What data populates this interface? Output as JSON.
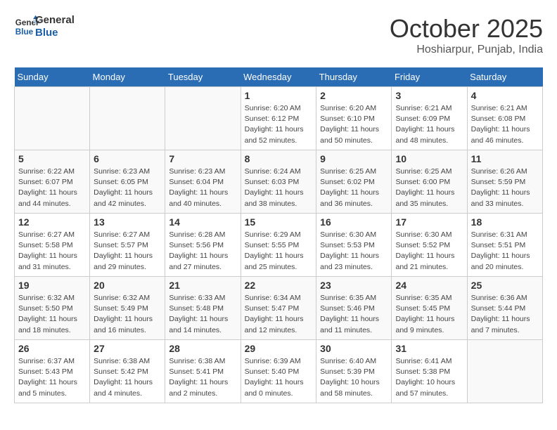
{
  "logo": {
    "line1": "General",
    "line2": "Blue"
  },
  "title": "October 2025",
  "location": "Hoshiarpur, Punjab, India",
  "weekdays": [
    "Sunday",
    "Monday",
    "Tuesday",
    "Wednesday",
    "Thursday",
    "Friday",
    "Saturday"
  ],
  "weeks": [
    [
      {
        "day": "",
        "info": ""
      },
      {
        "day": "",
        "info": ""
      },
      {
        "day": "",
        "info": ""
      },
      {
        "day": "1",
        "info": "Sunrise: 6:20 AM\nSunset: 6:12 PM\nDaylight: 11 hours\nand 52 minutes."
      },
      {
        "day": "2",
        "info": "Sunrise: 6:20 AM\nSunset: 6:10 PM\nDaylight: 11 hours\nand 50 minutes."
      },
      {
        "day": "3",
        "info": "Sunrise: 6:21 AM\nSunset: 6:09 PM\nDaylight: 11 hours\nand 48 minutes."
      },
      {
        "day": "4",
        "info": "Sunrise: 6:21 AM\nSunset: 6:08 PM\nDaylight: 11 hours\nand 46 minutes."
      }
    ],
    [
      {
        "day": "5",
        "info": "Sunrise: 6:22 AM\nSunset: 6:07 PM\nDaylight: 11 hours\nand 44 minutes."
      },
      {
        "day": "6",
        "info": "Sunrise: 6:23 AM\nSunset: 6:05 PM\nDaylight: 11 hours\nand 42 minutes."
      },
      {
        "day": "7",
        "info": "Sunrise: 6:23 AM\nSunset: 6:04 PM\nDaylight: 11 hours\nand 40 minutes."
      },
      {
        "day": "8",
        "info": "Sunrise: 6:24 AM\nSunset: 6:03 PM\nDaylight: 11 hours\nand 38 minutes."
      },
      {
        "day": "9",
        "info": "Sunrise: 6:25 AM\nSunset: 6:02 PM\nDaylight: 11 hours\nand 36 minutes."
      },
      {
        "day": "10",
        "info": "Sunrise: 6:25 AM\nSunset: 6:00 PM\nDaylight: 11 hours\nand 35 minutes."
      },
      {
        "day": "11",
        "info": "Sunrise: 6:26 AM\nSunset: 5:59 PM\nDaylight: 11 hours\nand 33 minutes."
      }
    ],
    [
      {
        "day": "12",
        "info": "Sunrise: 6:27 AM\nSunset: 5:58 PM\nDaylight: 11 hours\nand 31 minutes."
      },
      {
        "day": "13",
        "info": "Sunrise: 6:27 AM\nSunset: 5:57 PM\nDaylight: 11 hours\nand 29 minutes."
      },
      {
        "day": "14",
        "info": "Sunrise: 6:28 AM\nSunset: 5:56 PM\nDaylight: 11 hours\nand 27 minutes."
      },
      {
        "day": "15",
        "info": "Sunrise: 6:29 AM\nSunset: 5:55 PM\nDaylight: 11 hours\nand 25 minutes."
      },
      {
        "day": "16",
        "info": "Sunrise: 6:30 AM\nSunset: 5:53 PM\nDaylight: 11 hours\nand 23 minutes."
      },
      {
        "day": "17",
        "info": "Sunrise: 6:30 AM\nSunset: 5:52 PM\nDaylight: 11 hours\nand 21 minutes."
      },
      {
        "day": "18",
        "info": "Sunrise: 6:31 AM\nSunset: 5:51 PM\nDaylight: 11 hours\nand 20 minutes."
      }
    ],
    [
      {
        "day": "19",
        "info": "Sunrise: 6:32 AM\nSunset: 5:50 PM\nDaylight: 11 hours\nand 18 minutes."
      },
      {
        "day": "20",
        "info": "Sunrise: 6:32 AM\nSunset: 5:49 PM\nDaylight: 11 hours\nand 16 minutes."
      },
      {
        "day": "21",
        "info": "Sunrise: 6:33 AM\nSunset: 5:48 PM\nDaylight: 11 hours\nand 14 minutes."
      },
      {
        "day": "22",
        "info": "Sunrise: 6:34 AM\nSunset: 5:47 PM\nDaylight: 11 hours\nand 12 minutes."
      },
      {
        "day": "23",
        "info": "Sunrise: 6:35 AM\nSunset: 5:46 PM\nDaylight: 11 hours\nand 11 minutes."
      },
      {
        "day": "24",
        "info": "Sunrise: 6:35 AM\nSunset: 5:45 PM\nDaylight: 11 hours\nand 9 minutes."
      },
      {
        "day": "25",
        "info": "Sunrise: 6:36 AM\nSunset: 5:44 PM\nDaylight: 11 hours\nand 7 minutes."
      }
    ],
    [
      {
        "day": "26",
        "info": "Sunrise: 6:37 AM\nSunset: 5:43 PM\nDaylight: 11 hours\nand 5 minutes."
      },
      {
        "day": "27",
        "info": "Sunrise: 6:38 AM\nSunset: 5:42 PM\nDaylight: 11 hours\nand 4 minutes."
      },
      {
        "day": "28",
        "info": "Sunrise: 6:38 AM\nSunset: 5:41 PM\nDaylight: 11 hours\nand 2 minutes."
      },
      {
        "day": "29",
        "info": "Sunrise: 6:39 AM\nSunset: 5:40 PM\nDaylight: 11 hours\nand 0 minutes."
      },
      {
        "day": "30",
        "info": "Sunrise: 6:40 AM\nSunset: 5:39 PM\nDaylight: 10 hours\nand 58 minutes."
      },
      {
        "day": "31",
        "info": "Sunrise: 6:41 AM\nSunset: 5:38 PM\nDaylight: 10 hours\nand 57 minutes."
      },
      {
        "day": "",
        "info": ""
      }
    ]
  ]
}
